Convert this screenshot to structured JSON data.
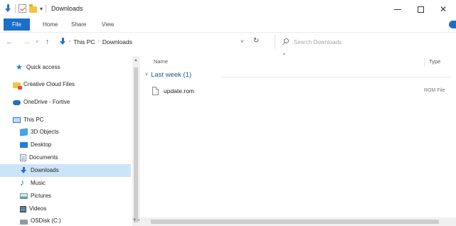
{
  "window": {
    "title": "Downloads",
    "qat_dropdown": "▾",
    "controls": {
      "minimize": "",
      "maximize": "",
      "close": "✕"
    }
  },
  "ribbon": {
    "tabs": [
      {
        "label": "File"
      },
      {
        "label": "Home"
      },
      {
        "label": "Share"
      },
      {
        "label": "View"
      }
    ]
  },
  "address": {
    "back": "←",
    "forward": "→",
    "recent": "˅",
    "up": "↑",
    "crumbs": [
      "This PC",
      "Downloads"
    ],
    "crumb_sep": "›",
    "dropdown": "˅",
    "refresh": "↻"
  },
  "search": {
    "placeholder": "Search Downloads"
  },
  "sidebar": {
    "items": [
      {
        "label": "Quick access",
        "icon": "star-icon"
      },
      {
        "label": "Creative Cloud Files",
        "icon": "creative-cloud-folder-icon"
      },
      {
        "label": "OneDrive - Fortive",
        "icon": "cloud-icon"
      },
      {
        "label": "This PC",
        "icon": "computer-icon"
      },
      {
        "label": "3D Objects",
        "icon": "3d-objects-icon"
      },
      {
        "label": "Desktop",
        "icon": "desktop-icon"
      },
      {
        "label": "Documents",
        "icon": "documents-icon"
      },
      {
        "label": "Downloads",
        "icon": "downloads-icon",
        "selected": true
      },
      {
        "label": "Music",
        "icon": "music-icon"
      },
      {
        "label": "Pictures",
        "icon": "pictures-icon"
      },
      {
        "label": "Videos",
        "icon": "videos-icon"
      },
      {
        "label": "OSDisk (C:)",
        "icon": "disk-icon"
      }
    ]
  },
  "content": {
    "columns": {
      "name": "Name",
      "type": "Type"
    },
    "group": {
      "label": "Last week (1)",
      "chevron": "˅"
    },
    "files": [
      {
        "name": "update.rom",
        "type": "ROM File"
      }
    ]
  },
  "colors": {
    "accent": "#1a6fc9",
    "selection": "#cce4f7",
    "group_text": "#1f57a7"
  }
}
